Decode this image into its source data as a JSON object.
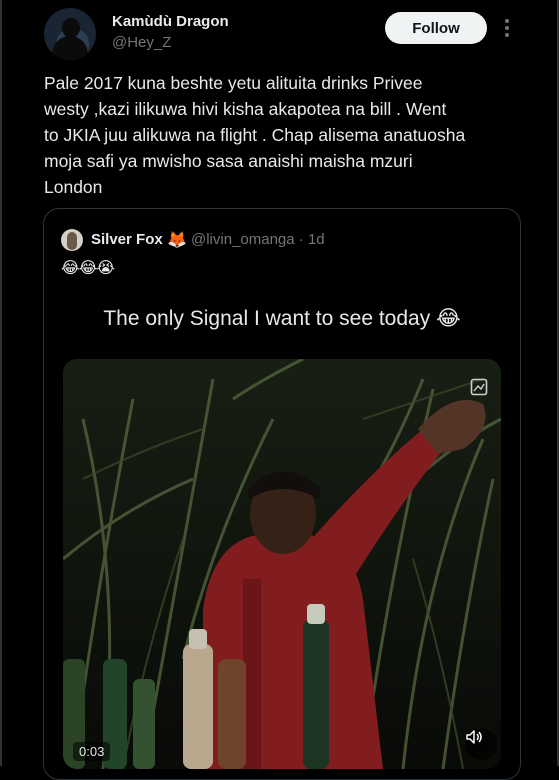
{
  "author": {
    "name": "Kamùdù Dragon",
    "handle": "@Hey_Z"
  },
  "actions": {
    "follow_label": "Follow",
    "more_icon": "more-vertical-icon"
  },
  "tweet": {
    "text": "Pale 2017 kuna beshte yetu alituita drinks Privee\nwesty ,kazi ilikuwa hivi kisha akapotea na bill . Went\nto JKIA juu alikuwa na flight . Chap alisema anatuosha\nmoja safi ya mwisho sasa anaishi maisha mzuri\nLondon"
  },
  "quote": {
    "name": "Silver Fox",
    "name_emoji": "🦊",
    "handle_time": "@livin_omanga · 1d",
    "emojis": "😂😂😭",
    "video": {
      "caption": "The only Signal I want to see today",
      "caption_emoji": "😂",
      "timestamp": "0:03",
      "gif_icon": "gif-icon",
      "volume_icon": "volume-icon"
    }
  },
  "colors": {
    "background": "#000000",
    "text": "#e7e9ea",
    "muted": "#71767b",
    "border": "#2f3336",
    "follow_bg": "#eff3f4"
  }
}
